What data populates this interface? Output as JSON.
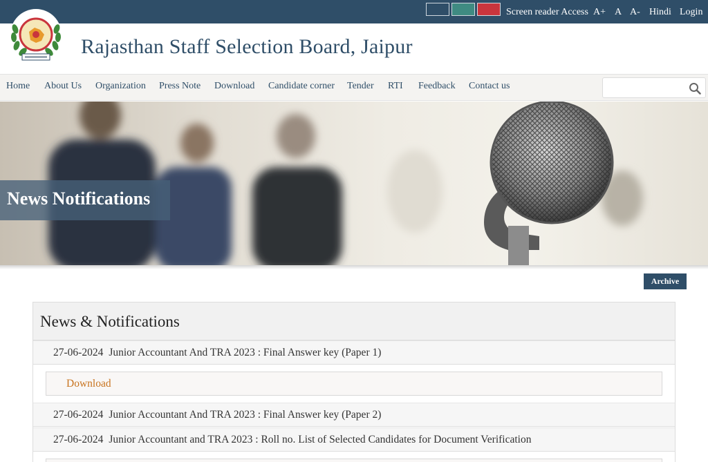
{
  "topbar": {
    "swatches": [
      {
        "name": "theme-blue-swatch",
        "color": "#2f4e68"
      },
      {
        "name": "theme-green-swatch",
        "color": "#3f8b82"
      },
      {
        "name": "theme-red-swatch",
        "color": "#c9353d"
      }
    ],
    "screen_reader": "Screen reader Access",
    "font_increase": "A+",
    "font_normal": "A",
    "font_decrease": "A-",
    "language": "Hindi",
    "login": "Login"
  },
  "header": {
    "title": "Rajasthan Staff Selection Board, Jaipur",
    "logo_icon": "rajasthan-emblem-icon"
  },
  "nav": {
    "items": [
      "Home",
      "About Us",
      "Organization",
      "Press Note",
      "Download",
      "Candidate corner",
      "Tender",
      "RTI",
      "Feedback",
      "Contact us"
    ],
    "search_placeholder": "",
    "search_icon": "search-icon"
  },
  "banner": {
    "title": "News Notifications"
  },
  "archive_label": "Archive",
  "news": {
    "title": "News & Notifications",
    "items": [
      {
        "date": "27-06-2024",
        "text": "Junior Accountant And TRA 2023 : Final Answer key (Paper 1)",
        "link": "Download"
      },
      {
        "date": "27-06-2024",
        "text": "Junior Accountant And TRA 2023 : Final Answer key (Paper 2)"
      },
      {
        "date": "27-06-2024",
        "text": "Junior Accountant and TRA 2023 : Roll no. List of Selected Candidates for Document Verification"
      }
    ]
  },
  "colors": {
    "brand": "#2f4e68",
    "link": "#c8731e"
  }
}
